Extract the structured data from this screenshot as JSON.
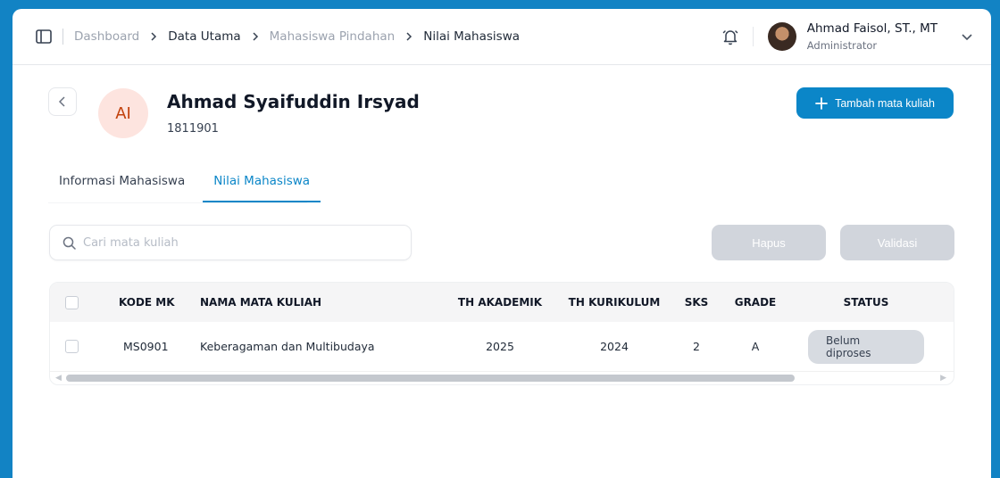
{
  "breadcrumb": [
    "Dashboard",
    "Data Utama",
    "Mahasiswa Pindahan",
    "Nilai Mahasiswa"
  ],
  "user": {
    "name": "Ahmad Faisol, ST., MT",
    "role": "Administrator"
  },
  "student": {
    "initials": "AI",
    "name": "Ahmad Syaifuddin Irsyad",
    "id": "1811901"
  },
  "actions": {
    "add_label": "Tambah mata kuliah",
    "delete_label": "Hapus",
    "validate_label": "Validasi"
  },
  "tabs": [
    {
      "label": "Informasi Mahasiswa",
      "active": false
    },
    {
      "label": "Nilai Mahasiswa",
      "active": true
    }
  ],
  "search": {
    "placeholder": "Cari mata kuliah",
    "value": ""
  },
  "table": {
    "headers": [
      "KODE MK",
      "NAMA MATA KULIAH",
      "TH AKADEMIK",
      "TH KURIKULUM",
      "SKS",
      "GRADE",
      "STATUS"
    ],
    "rows": [
      {
        "kode": "MS0901",
        "nama": "Keberagaman dan Multibudaya",
        "th_akademik": "2025",
        "th_kurikulum": "2024",
        "sks": "2",
        "grade": "A",
        "status": "Belum diproses"
      }
    ]
  },
  "colors": {
    "accent": "#0b86c8",
    "background": "#1283c4",
    "avatar_bg": "#fde4df",
    "avatar_text": "#c2410c",
    "disabled_button": "#d1d5dc"
  },
  "icons": [
    "sidebar-toggle-icon",
    "chevron-right-icon",
    "bell-icon",
    "chevron-down-icon",
    "chevron-left-icon",
    "plus-icon",
    "search-icon"
  ]
}
